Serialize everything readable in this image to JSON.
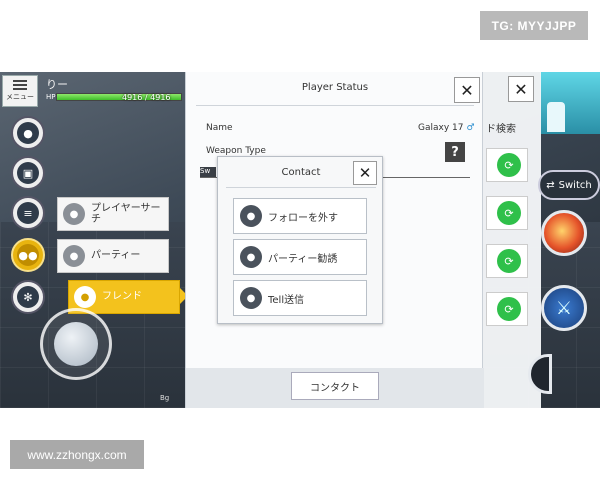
{
  "watermarks": {
    "top": "TG: MYYJJPP",
    "bottom": "www.zzhongx.com"
  },
  "hud": {
    "menu_label": "メニュー",
    "player_name": "りー",
    "hp_label": "HP",
    "hp_value": "4916 / 4916",
    "hp_fraction": 1.0,
    "corner_label": "Bg"
  },
  "side_icons": [
    "profile-icon",
    "bag-icon",
    "quest-icon",
    "friends-icon",
    "gear-icon"
  ],
  "submenu": {
    "player_search": "プレイヤーサーチ",
    "party": "パーティー",
    "friend": "フレンド"
  },
  "status_panel": {
    "title": "Player Status",
    "name_label": "Name",
    "name_value": "Galaxy 17",
    "gender_symbol": "♂",
    "weapon_label": "Weapon Type",
    "tab_stub": "Sw",
    "contact_button": "コンタクト"
  },
  "contact_dialog": {
    "title": "Contact",
    "options": [
      "フォローを外す",
      "パーティー勧誘",
      "Tell送信"
    ]
  },
  "right_panel": {
    "search_label": "ド検索",
    "switch_label": "Switch"
  },
  "colors": {
    "accent_yellow": "#f3c21d",
    "green_button": "#2fc04a",
    "hp_green": "#5fd43a"
  }
}
